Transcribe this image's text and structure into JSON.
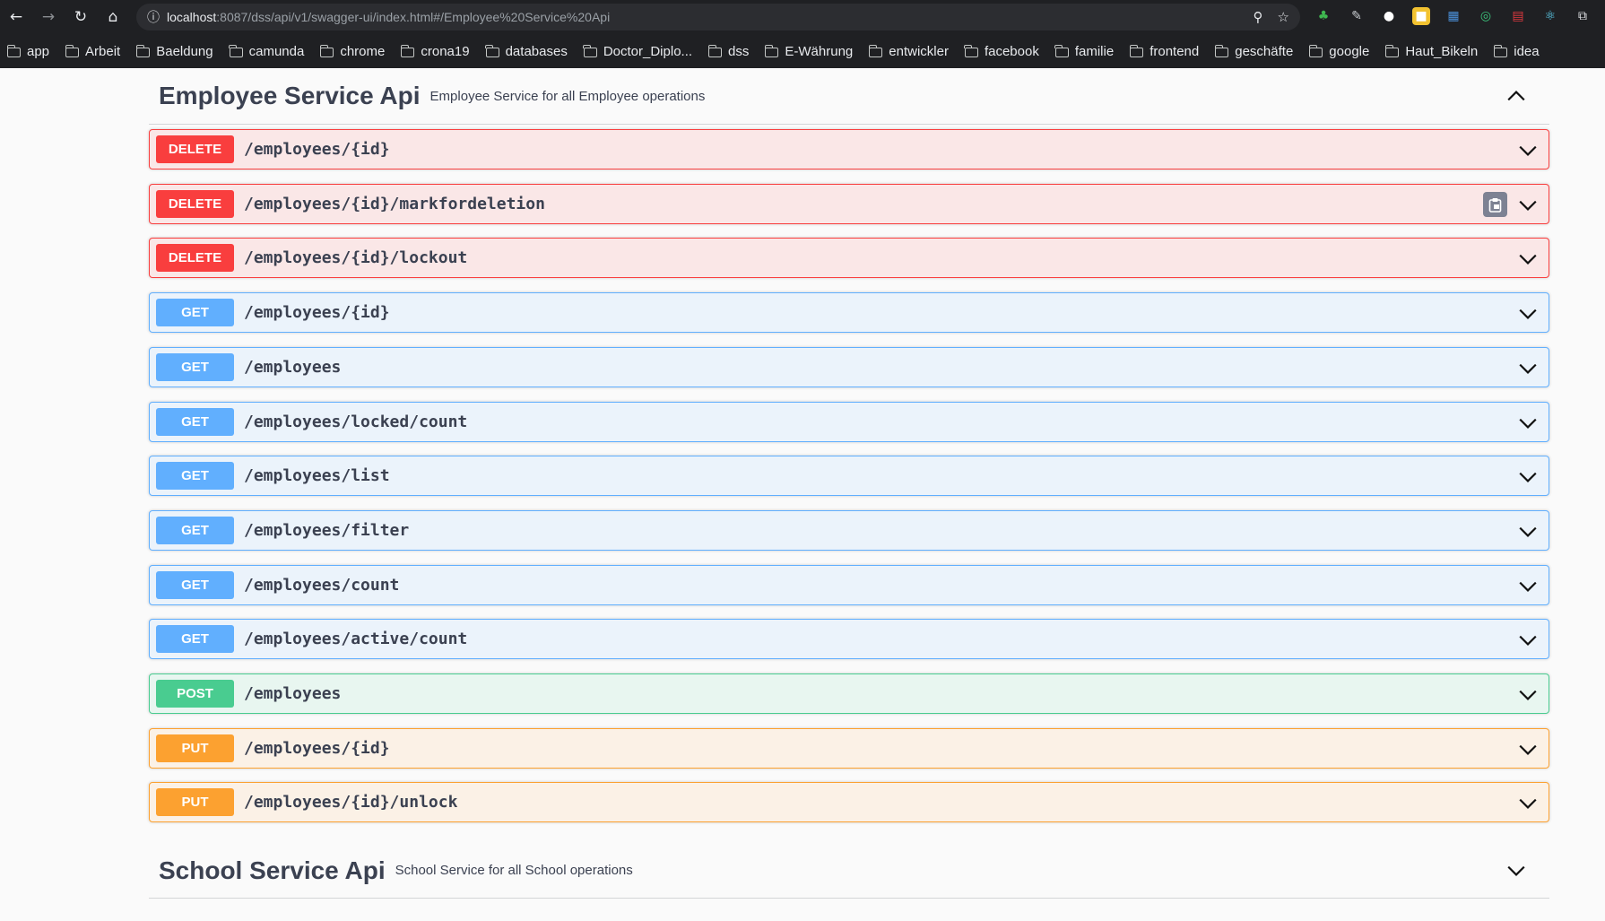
{
  "browser": {
    "url_host": "localhost",
    "url_rest": ":8087/dss/api/v1/swagger-ui/index.html#/Employee%20Service%20Api",
    "bookmarks": [
      "app",
      "Arbeit",
      "Baeldung",
      "camunda",
      "chrome",
      "crona19",
      "databases",
      "Doctor_Diplo...",
      "dss",
      "E-Währung",
      "entwickler",
      "facebook",
      "familie",
      "frontend",
      "geschäfte",
      "google",
      "Haut_Bikeln",
      "idea"
    ]
  },
  "sections": [
    {
      "title": "Employee Service Api",
      "description": "Employee Service for all Employee operations",
      "expanded": true,
      "operations": [
        {
          "method": "DELETE",
          "path": "/employees/{id}"
        },
        {
          "method": "DELETE",
          "path": "/employees/{id}/markfordeletion"
        },
        {
          "method": "DELETE",
          "path": "/employees/{id}/lockout"
        },
        {
          "method": "GET",
          "path": "/employees/{id}"
        },
        {
          "method": "GET",
          "path": "/employees"
        },
        {
          "method": "GET",
          "path": "/employees/locked/count"
        },
        {
          "method": "GET",
          "path": "/employees/list"
        },
        {
          "method": "GET",
          "path": "/employees/filter"
        },
        {
          "method": "GET",
          "path": "/employees/count"
        },
        {
          "method": "GET",
          "path": "/employees/active/count"
        },
        {
          "method": "POST",
          "path": "/employees"
        },
        {
          "method": "PUT",
          "path": "/employees/{id}"
        },
        {
          "method": "PUT",
          "path": "/employees/{id}/unlock"
        }
      ]
    },
    {
      "title": "School Service Api",
      "description": "School Service for all School operations",
      "expanded": false
    }
  ],
  "colors": {
    "delete": "#f93e3e",
    "get": "#61affe",
    "post": "#49cc90",
    "put": "#fca130",
    "text": "#3b4151"
  }
}
